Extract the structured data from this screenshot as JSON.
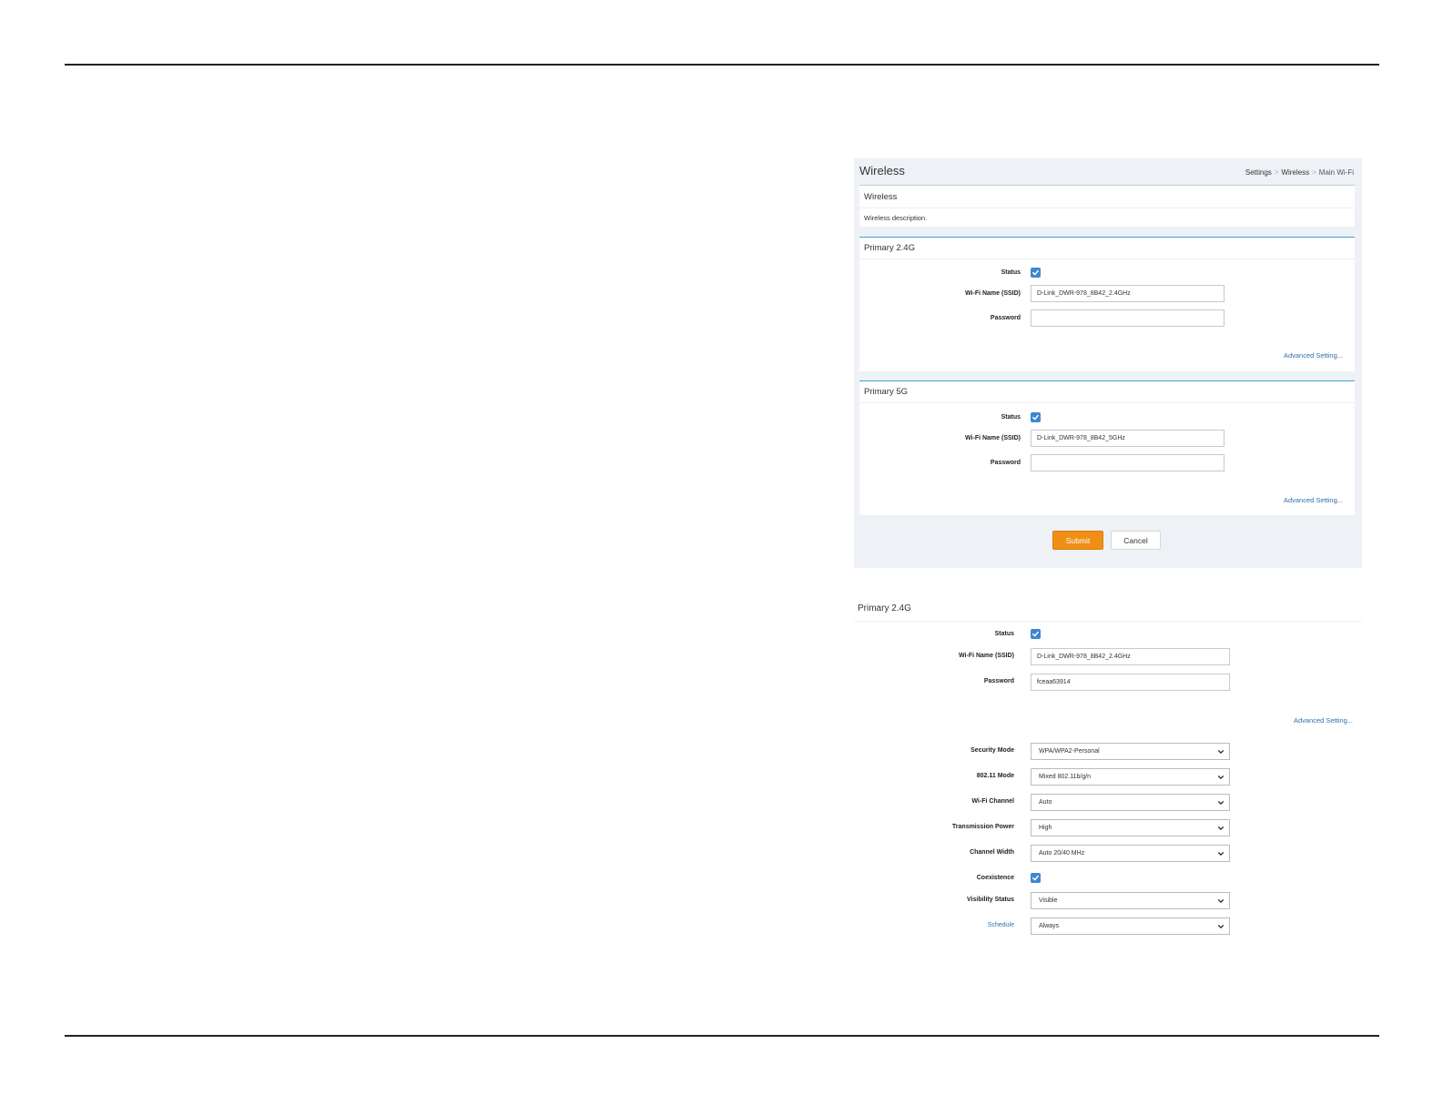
{
  "main_panel": {
    "title": "Wireless",
    "breadcrumb": [
      "Settings",
      "Wireless",
      "Main Wi-Fi"
    ],
    "breadcrumb_separator": ">",
    "description_card": {
      "title": "Wireless",
      "text": "Wireless description."
    },
    "bands": [
      {
        "title": "Primary 2.4G",
        "status_label": "Status",
        "status_checked": true,
        "ssid_label": "Wi-Fi Name (SSID)",
        "ssid_value": "D-Link_DWR-978_8B42_2.4GHz",
        "password_label": "Password",
        "password_value": "",
        "advanced_link": "Advanced Setting..."
      },
      {
        "title": "Primary 5G",
        "status_label": "Status",
        "status_checked": true,
        "ssid_label": "Wi-Fi Name (SSID)",
        "ssid_value": "D-Link_DWR-978_8B42_5GHz",
        "password_label": "Password",
        "password_value": "",
        "advanced_link": "Advanced Setting..."
      }
    ],
    "submit_label": "Submit",
    "cancel_label": "Cancel"
  },
  "detail_panel": {
    "title": "Primary 2.4G",
    "status_label": "Status",
    "status_checked": true,
    "ssid_label": "Wi-Fi Name (SSID)",
    "ssid_value": "D-Link_DWR-978_8B42_2.4GHz",
    "password_label": "Password",
    "password_value": "fceaa63914",
    "advanced_link": "Advanced Setting...",
    "security_mode_label": "Security Mode",
    "security_mode_value": "WPA/WPA2-Personal",
    "mode_80211_label": "802.11 Mode",
    "mode_80211_value": "Mixed 802.11b/g/n",
    "channel_label": "Wi-Fi Channel",
    "channel_value": "Auto",
    "tx_power_label": "Transmission Power",
    "tx_power_value": "High",
    "channel_width_label": "Channel Width",
    "channel_width_value": "Auto 20/40 MHz",
    "coexistence_label": "Coexistence",
    "coexistence_checked": true,
    "visibility_label": "Visibility Status",
    "visibility_value": "Visible",
    "schedule_label": "Schedule",
    "schedule_value": "Always"
  },
  "colors": {
    "accent_blue": "#3ba3d9",
    "checkbox_blue": "#3f86d2",
    "submit_orange": "#ef8f15",
    "link_blue": "#2f6fa7",
    "panel_bg": "#eef1f5"
  },
  "icons": {
    "checkbox": "checkmark-icon",
    "select_caret": "chevron-down-icon"
  }
}
